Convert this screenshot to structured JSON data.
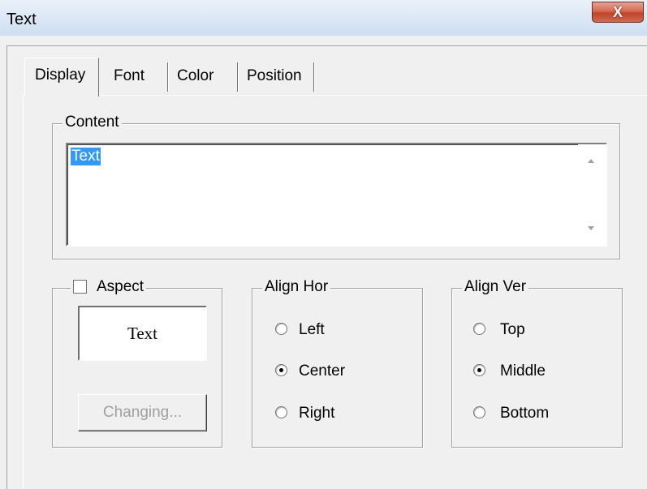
{
  "window": {
    "title": "Text",
    "close_glyph": "X"
  },
  "tabs": [
    {
      "label": "Display",
      "active": true
    },
    {
      "label": "Font",
      "active": false
    },
    {
      "label": "Color",
      "active": false
    },
    {
      "label": "Position",
      "active": false
    }
  ],
  "content": {
    "group_label": "Content",
    "text": "Text"
  },
  "aspect": {
    "label": "Aspect",
    "checked": false,
    "preview_text": "Text",
    "changing_button": "Changing..."
  },
  "align_hor": {
    "label": "Align Hor",
    "options": [
      "Left",
      "Center",
      "Right"
    ],
    "selected": "Center"
  },
  "align_ver": {
    "label": "Align Ver",
    "options": [
      "Top",
      "Middle",
      "Bottom"
    ],
    "selected": "Middle"
  }
}
